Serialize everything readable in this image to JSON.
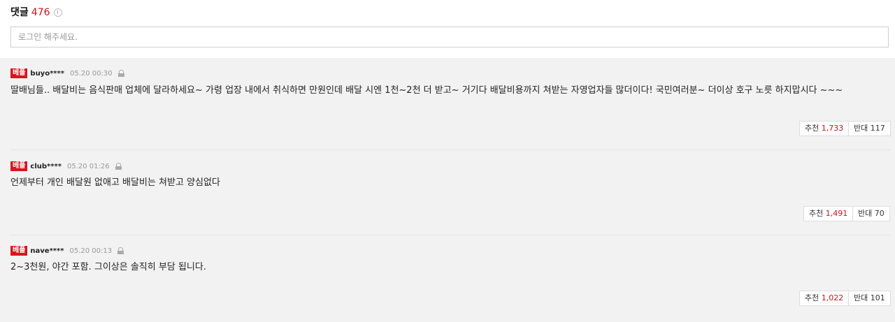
{
  "comments_section": {
    "title": "댓글",
    "count": "476",
    "info_icon": "i",
    "input_placeholder": "로그인 해주세요."
  },
  "badge_label": "베플",
  "comments": [
    {
      "user": "buyo****",
      "time": "05.20 00:30",
      "text": "딸배님들.. 배달비는 음식판매 업체에 달라하세요~ 가령 업장 내에서 취식하면 만원인데 배달 시엔 1천~2천 더 받고~ 거기다 배달비용까지 쳐받는 자영업자들 많더이다! 국민여러분~ 더이상 호구 노릇 하지맙시다 ~~~",
      "up_label": "추천",
      "up_count": "1,733",
      "down_label": "반대",
      "down_count": "117"
    },
    {
      "user": "club****",
      "time": "05.20 01:26",
      "text": "언제부터 개인 배달원 없애고 배달비는 쳐받고 양심없다",
      "up_label": "추천",
      "up_count": "1,491",
      "down_label": "반대",
      "down_count": "70"
    },
    {
      "user": "nave****",
      "time": "05.20 00:13",
      "text": "2~3천원, 야간 포함. 그이상은 솔직히 부담 됩니다.",
      "up_label": "추천",
      "up_count": "1,022",
      "down_label": "반대",
      "down_count": "101"
    }
  ],
  "colors": {
    "accent": "#c4161c",
    "badge": "#d5161d",
    "list_bg": "#f2f2f2"
  }
}
